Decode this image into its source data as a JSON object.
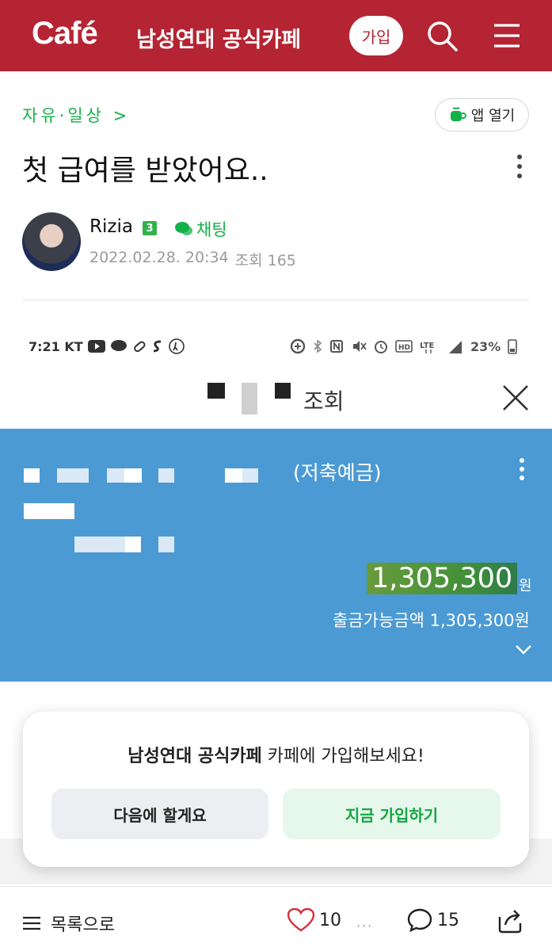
{
  "header": {
    "logo": "Café",
    "cafe_name": "남성연대 공식카페",
    "join_label": "가입"
  },
  "post": {
    "board": "자유·일상 >",
    "app_open_label": "앱 열기",
    "title": "첫 급여를 받았어요..",
    "author": "Rizia",
    "author_level": "3",
    "chat_label": "채팅",
    "date": "2022.02.28. 20:34",
    "views_label": "조회 165"
  },
  "screenshot": {
    "status_time": "7:21 KT",
    "status_battery": "23%",
    "title": "조회",
    "account_type": "(저축예금)",
    "balance": "1,305,300",
    "currency": "원",
    "available": "출금가능금액 1,305,300원"
  },
  "modal": {
    "cafe_name": "남성연대 공식카페",
    "message": " 카페에 가입해보세요!",
    "later_label": "다음에 할게요",
    "join_label": "지금 가입하기"
  },
  "bottom": {
    "list_label": "목록으로",
    "likes": "10",
    "more": "···",
    "comments": "15"
  },
  "colors": {
    "brand": "#b52433",
    "accent_green": "#14b14a",
    "bank_blue": "#4b9ad4"
  }
}
